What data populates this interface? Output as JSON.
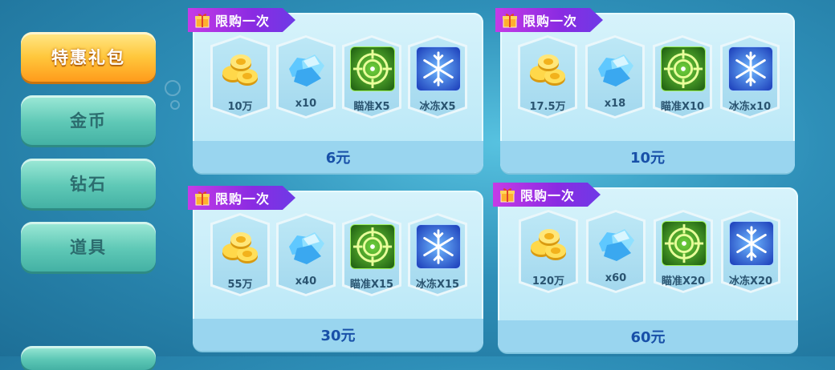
{
  "sidebar": {
    "items": [
      {
        "label": "特惠礼包",
        "active": true
      },
      {
        "label": "金币"
      },
      {
        "label": "钻石"
      },
      {
        "label": "道具"
      }
    ]
  },
  "packs": [
    {
      "tag": "限购一次",
      "price": "6元",
      "items": [
        {
          "icon": "gold-coins-icon",
          "label": "10万"
        },
        {
          "icon": "blue-diamond-icon",
          "label": "x10"
        },
        {
          "icon": "aim-target-icon",
          "label": "瞄准X5"
        },
        {
          "icon": "snowflake-freeze-icon",
          "label": "冰冻X5"
        }
      ]
    },
    {
      "tag": "限购一次",
      "price": "10元",
      "items": [
        {
          "icon": "gold-coins-icon",
          "label": "17.5万"
        },
        {
          "icon": "blue-diamond-icon",
          "label": "x18"
        },
        {
          "icon": "aim-target-icon",
          "label": "瞄准X10"
        },
        {
          "icon": "snowflake-freeze-icon",
          "label": "冰冻x10"
        }
      ]
    },
    {
      "tag": "限购一次",
      "price": "30元",
      "items": [
        {
          "icon": "gold-coins-icon",
          "label": "55万"
        },
        {
          "icon": "blue-diamond-icon",
          "label": "x40"
        },
        {
          "icon": "aim-target-icon",
          "label": "瞄准X15"
        },
        {
          "icon": "snowflake-freeze-icon",
          "label": "冰冻X15"
        }
      ]
    },
    {
      "tag": "限购一次",
      "price": "60元",
      "items": [
        {
          "icon": "gold-coins-icon",
          "label": "120万"
        },
        {
          "icon": "blue-diamond-icon",
          "label": "x60"
        },
        {
          "icon": "aim-target-icon",
          "label": "瞄准X20"
        },
        {
          "icon": "snowflake-freeze-icon",
          "label": "冰冻X20"
        }
      ]
    }
  ],
  "colors": {
    "active_tab": "#ffc73c",
    "tab": "#5ec8b6",
    "price_text": "#1850a8",
    "tag": "#a236e3"
  }
}
